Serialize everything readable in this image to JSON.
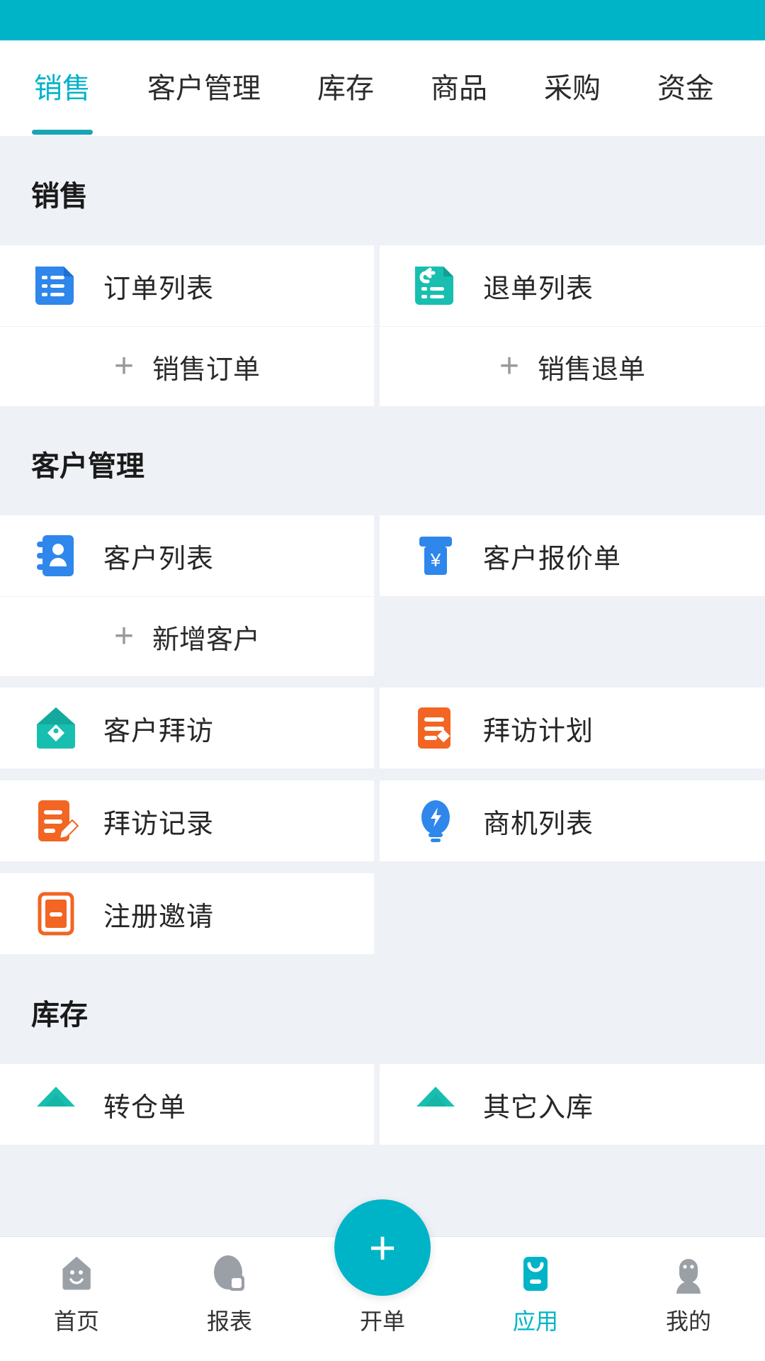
{
  "status_bar": {
    "color": "#00b4c8"
  },
  "theme": {
    "accent": "#00b4c8",
    "bg": "#eef1f6",
    "card": "#ffffff",
    "blue": "#2f86eb",
    "teal": "#18bfb0",
    "orange": "#f26522"
  },
  "tabs": [
    {
      "label": "销售",
      "active": true
    },
    {
      "label": "客户管理",
      "active": false
    },
    {
      "label": "库存",
      "active": false
    },
    {
      "label": "商品",
      "active": false
    },
    {
      "label": "采购",
      "active": false
    },
    {
      "label": "资金",
      "active": false
    }
  ],
  "sections": [
    {
      "title": "销售",
      "items": [
        {
          "label": "订单列表",
          "icon": "order-list-icon",
          "color": "#2f86eb"
        },
        {
          "label": "退单列表",
          "icon": "return-list-icon",
          "color": "#18bfb0"
        }
      ],
      "adds": [
        {
          "label": "销售订单"
        },
        {
          "label": "销售退单"
        }
      ]
    },
    {
      "title": "客户管理",
      "items": [
        {
          "label": "客户列表",
          "icon": "customer-book-icon",
          "color": "#2f86eb"
        },
        {
          "label": "客户报价单",
          "icon": "price-tag-yuan-icon",
          "color": "#2f86eb"
        }
      ],
      "adds": [
        {
          "label": "新增客户"
        }
      ],
      "items2": [
        {
          "label": "客户拜访",
          "icon": "house-tag-icon",
          "color": "#18bfb0"
        },
        {
          "label": "拜访计划",
          "icon": "plan-doc-icon",
          "color": "#f26522"
        },
        {
          "label": "拜访记录",
          "icon": "record-pen-icon",
          "color": "#f26522"
        },
        {
          "label": "商机列表",
          "icon": "lightbulb-bolt-icon",
          "color": "#2f86eb"
        },
        {
          "label": "注册邀请",
          "icon": "invite-card-icon",
          "color": "#f26522"
        }
      ]
    },
    {
      "title": "库存",
      "items": [
        {
          "label": "转仓单",
          "icon": "transfer-icon",
          "color": "#18bfb0"
        },
        {
          "label": "其它入库",
          "icon": "inbound-icon",
          "color": "#18bfb0"
        }
      ]
    }
  ],
  "bottom_nav": {
    "items": [
      {
        "label": "首页",
        "icon": "home-smile-icon",
        "active": false
      },
      {
        "label": "报表",
        "icon": "report-chart-icon",
        "active": false
      },
      {
        "label": "开单",
        "icon": "plus-fab-icon",
        "active": false,
        "fab": true
      },
      {
        "label": "应用",
        "icon": "apps-grid-icon",
        "active": true
      },
      {
        "label": "我的",
        "icon": "user-avatar-icon",
        "active": false
      }
    ]
  }
}
